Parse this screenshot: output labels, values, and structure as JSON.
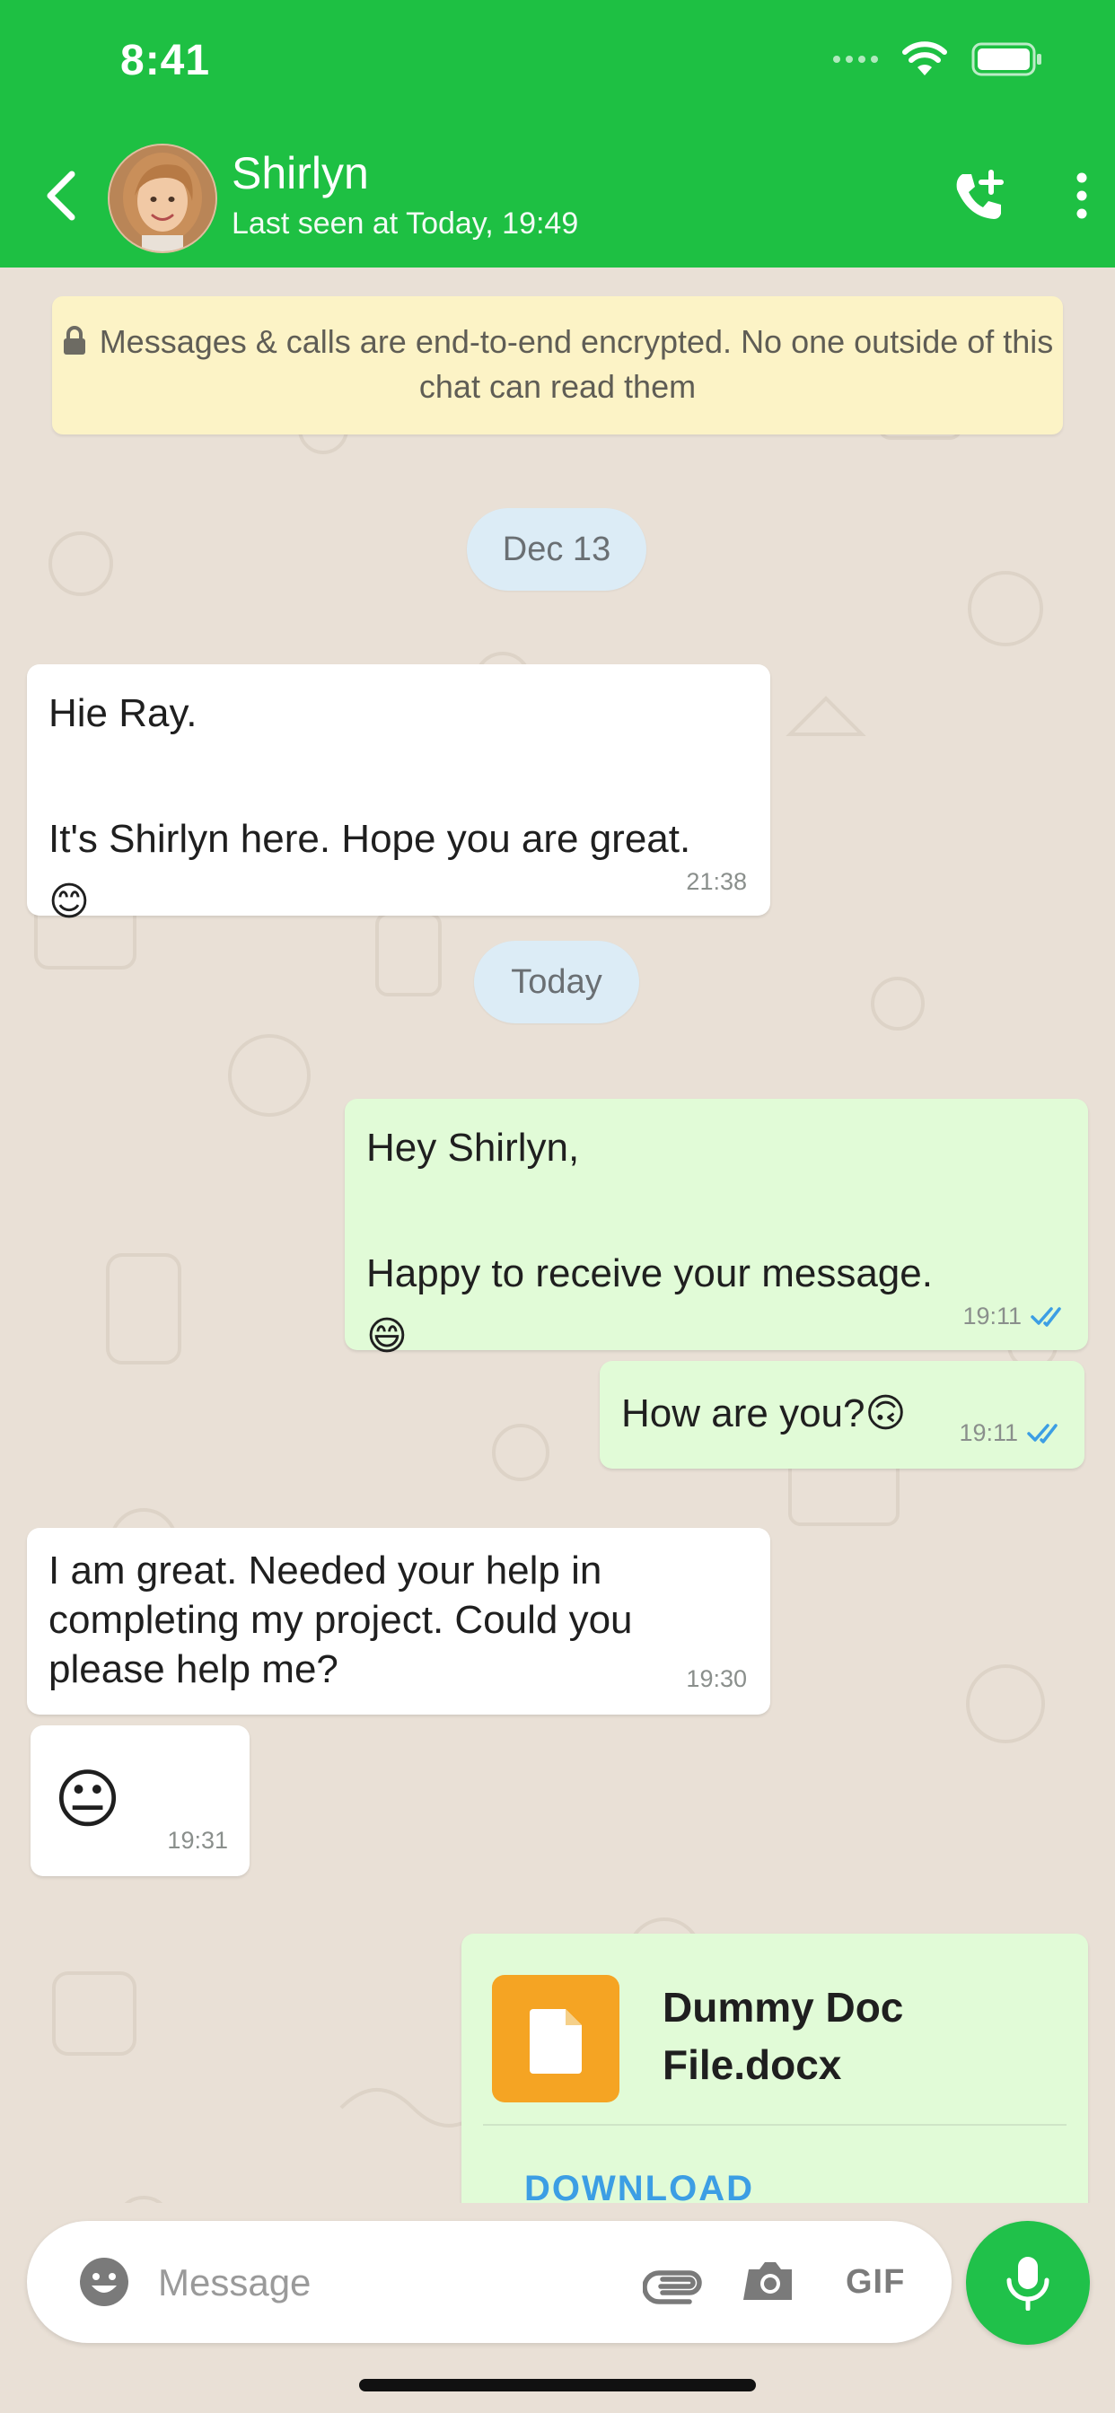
{
  "status_bar": {
    "time": "8:41"
  },
  "header": {
    "contact_name": "Shirlyn",
    "last_seen": "Last seen at Today, 19:49",
    "icons": [
      "back-icon",
      "add-call-icon",
      "more-icon"
    ]
  },
  "notice": {
    "text": "Messages & calls are end-to-end encrypted. No one outside of this chat can read them"
  },
  "dates": {
    "first": "Dec 13",
    "second": "Today"
  },
  "messages": [
    {
      "direction": "in",
      "text": "Hie Ray.\n\nIt's Shirlyn here. Hope you are great.😊",
      "time": "21:38"
    },
    {
      "direction": "out",
      "text": "Hey Shirlyn,\n\nHappy to receive your message. 😄",
      "time": "19:11",
      "status": "read"
    },
    {
      "direction": "out",
      "text": "How are you?🙃",
      "time": "19:11",
      "status": "read"
    },
    {
      "direction": "in",
      "text": "I am great. Needed your help in completing my project. Could you please help me?",
      "time": "19:30"
    },
    {
      "direction": "in",
      "text": "😐",
      "time": "19:31"
    }
  ],
  "document": {
    "file_name": "Dummy Doc File.docx",
    "action": "DOWNLOAD"
  },
  "composer": {
    "placeholder": "Message",
    "gif_label": "GIF"
  },
  "colors": {
    "header": "#1ec043",
    "incoming": "#ffffff",
    "outgoing": "#e1fbd7",
    "read_ticks": "#3c9ee4",
    "notice_bg": "#fcf3c6"
  }
}
